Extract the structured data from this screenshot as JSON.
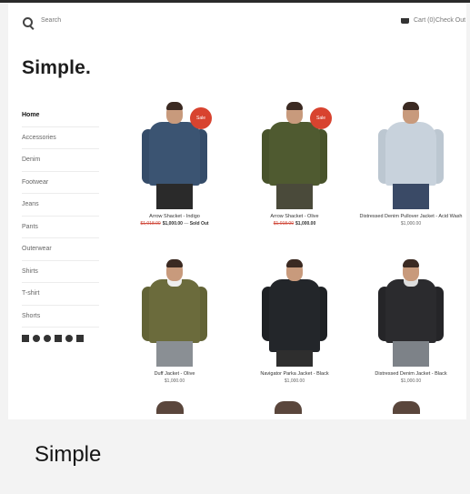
{
  "header": {
    "search_label": "Search",
    "cart_label": "Cart (0)",
    "checkout_label": "Check Out"
  },
  "brand": {
    "logo": "Simple."
  },
  "sidebar": {
    "items": [
      {
        "label": "Home",
        "active": true
      },
      {
        "label": "Accessories"
      },
      {
        "label": "Denim"
      },
      {
        "label": "Footwear"
      },
      {
        "label": "Jeans"
      },
      {
        "label": "Pants"
      },
      {
        "label": "Outerwear"
      },
      {
        "label": "Shirts"
      },
      {
        "label": "T-shirt"
      },
      {
        "label": "Shorts"
      }
    ],
    "social_icons": [
      "facebook-icon",
      "twitter-icon",
      "pinterest-icon",
      "instagram-icon",
      "snapchat-icon",
      "vine-icon"
    ]
  },
  "products": [
    {
      "name": "Arrow Shacket - Indigo",
      "old_price": "$1,018.00",
      "price": "$1,000.00",
      "sale_text": "Sold Out",
      "badge": "Sale"
    },
    {
      "name": "Arrow Shacket - Olive",
      "old_price": "$1,018.00",
      "price": "$1,000.00",
      "badge": "Sale"
    },
    {
      "name": "Distressed Denim Pullover Jacket - Acid Wash",
      "price": "$1,000.00"
    },
    {
      "name": "Duff Jacket - Olive",
      "price": "$1,000.00"
    },
    {
      "name": "Navigator Parka Jacket - Black",
      "price": "$1,000.00"
    },
    {
      "name": "Distressed Denim Jacket - Black",
      "price": "$1,000.00"
    }
  ],
  "caption": "Simple",
  "colors": {
    "sale_badge": "#d8432f",
    "old_price": "#d04a3c",
    "indigo": "#3b5472",
    "olive": "#4f5a30",
    "acid_wash": "#c8d2dc",
    "duff_olive": "#6b6b3c",
    "parka_black": "#23262a",
    "denim_black": "#2b2b2e"
  }
}
